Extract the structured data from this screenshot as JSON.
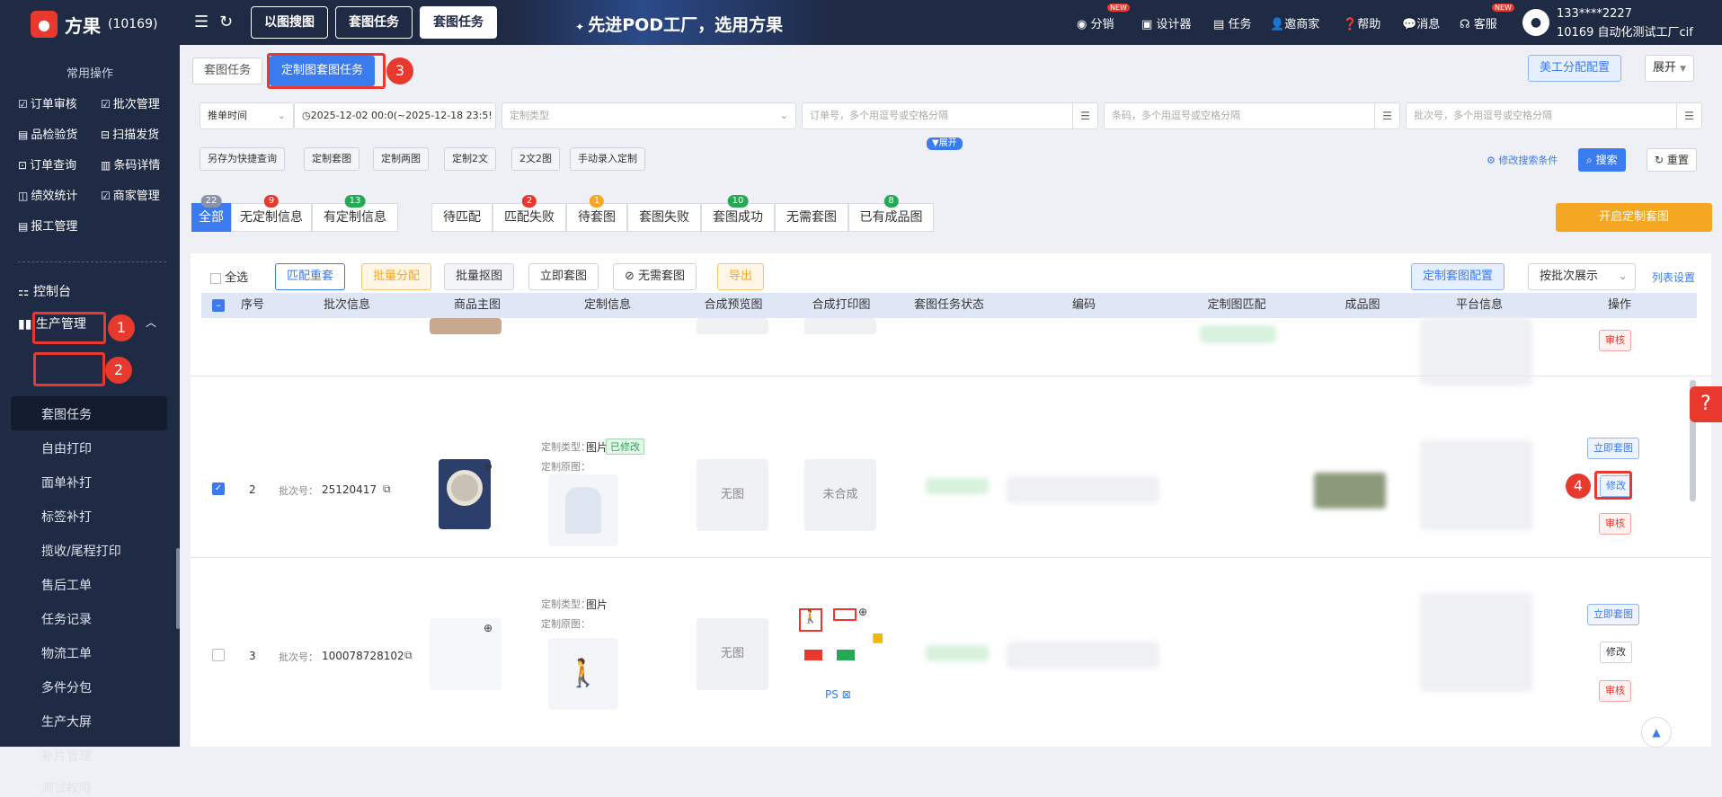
{
  "header": {
    "logo_text": "方果",
    "logo_id": "(10169)",
    "tabs": [
      "以图搜图",
      "套图任务",
      "套图任务"
    ],
    "slogan": "先进POD工厂，选用方果",
    "nav": {
      "distribution": "分销",
      "designer": "设计器",
      "task": "任务",
      "invite": "邀商家",
      "help": "帮助",
      "message": "消息",
      "service": "客服",
      "new_badge": "NEW"
    },
    "user": {
      "phone": "133****2227",
      "company": "10169 自动化测试工厂cif"
    }
  },
  "sidebar": {
    "section_title": "常用操作",
    "quick": [
      "订单审核",
      "批次管理",
      "品检验货",
      "扫描发货",
      "订单查询",
      "条码详情",
      "绩效统计",
      "商家管理",
      "报工管理"
    ],
    "dashboard": "控制台",
    "production": "生产管理",
    "sub_items": [
      "套图任务",
      "自由打印",
      "面单补打",
      "标签补打",
      "揽收/尾程打印",
      "售后工单",
      "任务记录",
      "物流工单",
      "多件分包",
      "生产大屏",
      "补片管理",
      "测试权限"
    ]
  },
  "annotations": [
    "1",
    "2",
    "3",
    "4"
  ],
  "page": {
    "tabs": [
      "套图任务",
      "定制图套图任务"
    ],
    "art_assign": "美工分配配置",
    "expand_label": "展开",
    "filters": {
      "time_type": "推单时间",
      "date_range": "2025-12-02 00:0(~2025-12-18 23:5!",
      "custom_type_ph": "定制类型",
      "order_ph": "订单号，多个用逗号或空格分隔",
      "barcode_ph": "条码，多个用逗号或空格分隔",
      "batch_ph": "批次号，多个用逗号或空格分隔"
    },
    "quick_buttons": [
      "另存为快捷查询",
      "定制套图",
      "定制两图",
      "定制2文",
      "2文2图",
      "手动录入定制"
    ],
    "expand_toggle": "▼展开",
    "edit_search": "修改搜索条件",
    "search": "搜索",
    "reset": "重置",
    "stat_tabs": [
      {
        "label": "全部",
        "count": "22",
        "color": "#8a93a8"
      },
      {
        "label": "无定制信息",
        "count": "9",
        "color": "#e8392f"
      },
      {
        "label": "有定制信息",
        "count": "13",
        "color": "#27a857"
      },
      {
        "label": "待匹配",
        "count": "",
        "color": ""
      },
      {
        "label": "匹配失败",
        "count": "2",
        "color": "#e8392f"
      },
      {
        "label": "待套图",
        "count": "1",
        "color": "#f5a623"
      },
      {
        "label": "套图失败",
        "count": "",
        "color": ""
      },
      {
        "label": "套图成功",
        "count": "10",
        "color": "#27a857"
      },
      {
        "label": "无需套图",
        "count": "",
        "color": ""
      },
      {
        "label": "已有成品图",
        "count": "8",
        "color": "#27a857"
      }
    ],
    "start_task": "开启定制套图",
    "toolbar": {
      "select_all": "全选",
      "rematch": "匹配重套",
      "batch_assign": "批量分配",
      "batch_cutout": "批量抠图",
      "instant": "立即套图",
      "no_need": "无需套图",
      "export": "导出",
      "config": "定制套图配置",
      "display_mode": "按批次展示",
      "list_settings": "列表设置"
    },
    "columns": [
      "序号",
      "批次信息",
      "商品主图",
      "定制信息",
      "合成预览图",
      "合成打印图",
      "套图任务状态",
      "编码",
      "定制图匹配",
      "成品图",
      "平台信息",
      "操作"
    ],
    "rows": [
      {
        "no": "2",
        "batch_label": "批次号：",
        "batch_no": "25120417",
        "custom_type_label": "定制类型：",
        "custom_type": "图片",
        "modified": "已修改",
        "origin_label": "定制原图：",
        "preview": "无图",
        "print": "未合成",
        "actions": [
          "立即套图",
          "修改",
          "审核"
        ]
      },
      {
        "no": "3",
        "batch_label": "批次号：",
        "batch_no": "100078728102",
        "custom_type_label": "定制类型：",
        "custom_type": "图片",
        "origin_label": "定制原图：",
        "preview": "无图",
        "ps_label": "PS",
        "actions": [
          "立即套图",
          "修改",
          "审核"
        ]
      }
    ],
    "top_row_action": "审核"
  }
}
